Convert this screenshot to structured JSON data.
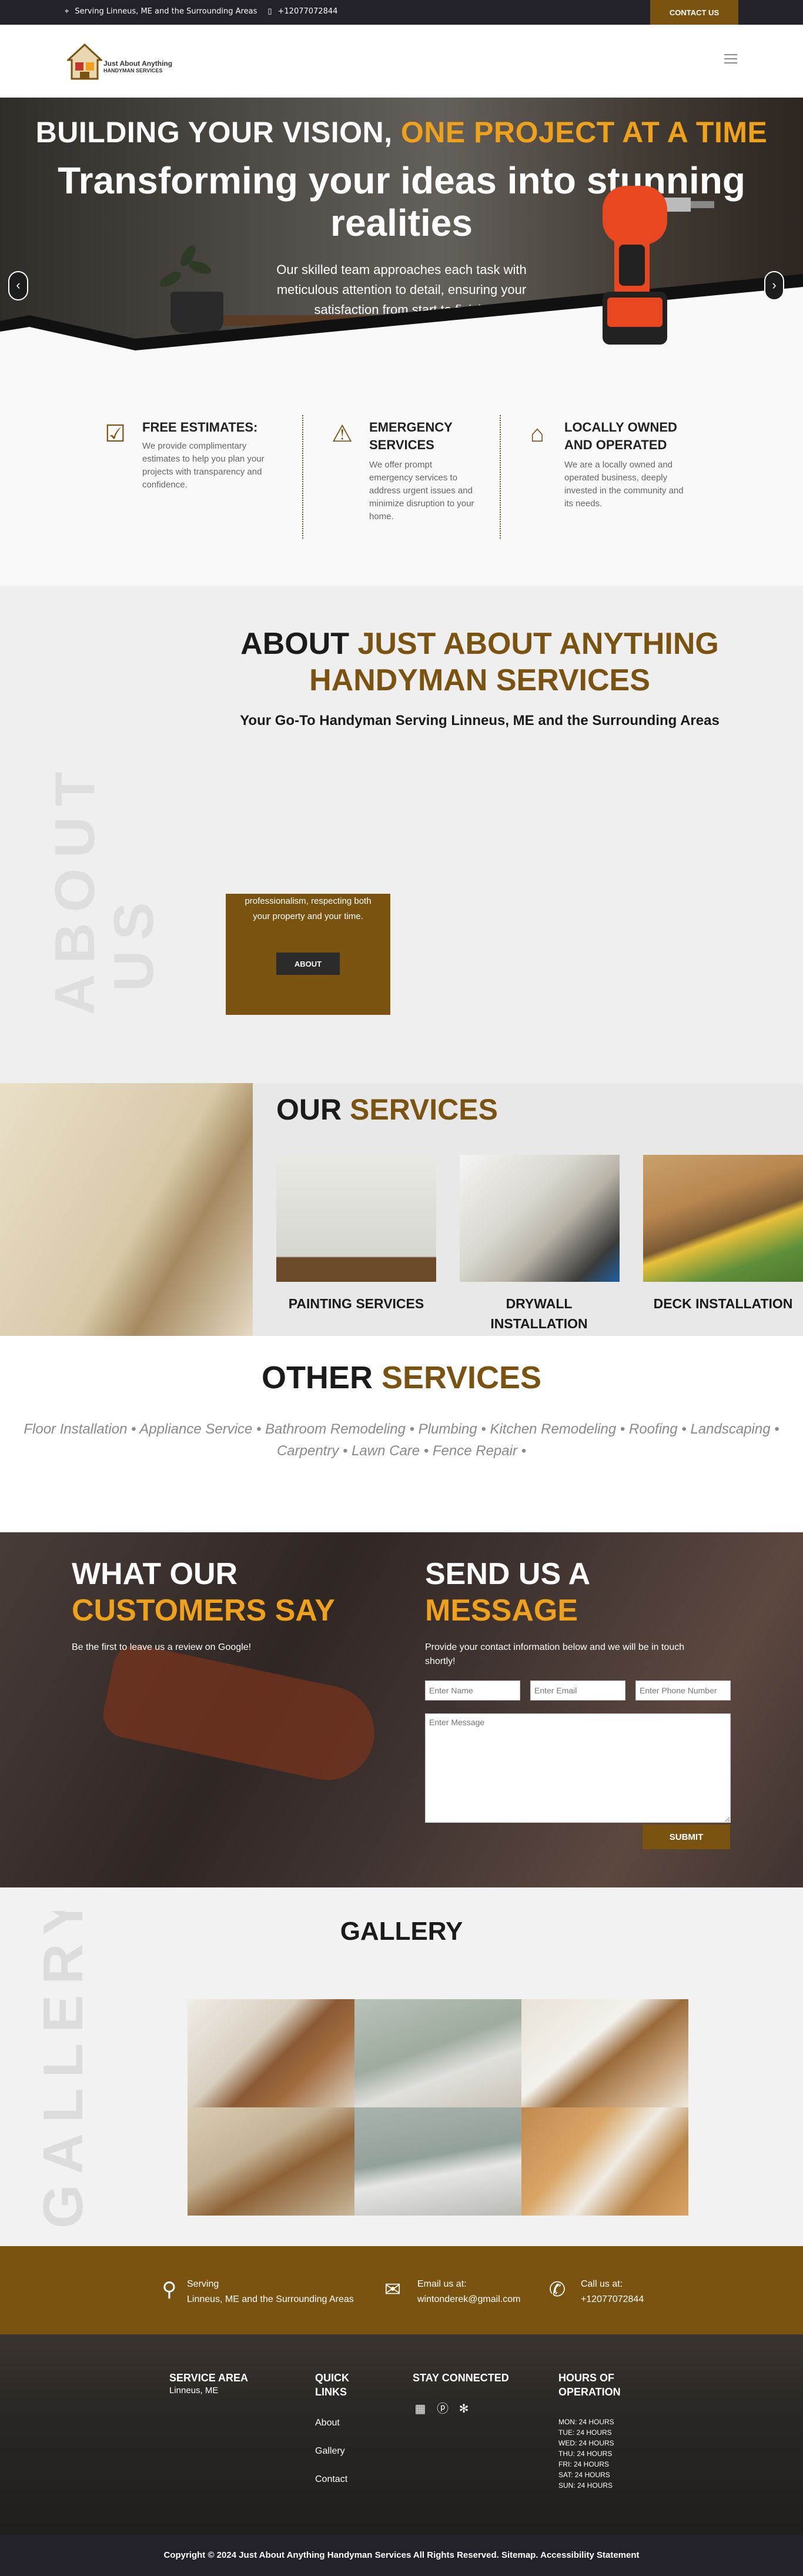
{
  "topbar": {
    "location": "Serving Linneus, ME and the Surrounding Areas",
    "phone": "+12077072844",
    "contact_button": "CONTACT US"
  },
  "logo": {
    "line1": "Just About Anything",
    "line2": "HANDYMAN SERVICES"
  },
  "hero": {
    "tagline_part1": "BUILDING YOUR VISION, ",
    "tagline_part2": "ONE PROJECT AT A TIME",
    "headline": "Transforming your ideas into stunning realities",
    "body": "Our skilled team approaches each task with meticulous attention to detail, ensuring your satisfaction from start to finish.",
    "prev_arrow": "‹",
    "next_arrow": "›"
  },
  "features": [
    {
      "icon": "checklist-icon",
      "title": "FREE ESTIMATES:",
      "text": "We provide complimentary estimates to help you plan your projects with transparency and confidence."
    },
    {
      "icon": "siren-icon",
      "title": "EMERGENCY SERVICES",
      "text": "We offer prompt emergency services to address urgent issues and minimize disruption to your home."
    },
    {
      "icon": "storefront-icon",
      "title": "LOCALLY OWNED AND OPERATED",
      "text": "We are a locally owned and operated business, deeply invested in the community and its needs."
    }
  ],
  "about": {
    "title_part1": "ABOUT ",
    "title_part2": "JUST ABOUT ANYTHING HANDYMAN SERVICES",
    "subtitle": "Your Go-To Handyman Serving Linneus, ME and the Surrounding Areas",
    "ghost_text_1": "ABOUT",
    "ghost_text_2": "US",
    "box_text": "professionalism, respecting both your property and your time.",
    "button": "ABOUT"
  },
  "services": {
    "title_part1": "OUR ",
    "title_part2": "SERVICES",
    "items": [
      {
        "label": "PAINTING SERVICES"
      },
      {
        "label": "DRYWALL INSTALLATION"
      },
      {
        "label": "DECK INSTALLATION"
      }
    ]
  },
  "other_services": {
    "title_part1": "OTHER ",
    "title_part2": "SERVICES",
    "list": "Floor Installation • Appliance Service • Bathroom Remodeling • Plumbing • Kitchen Remodeling • Roofing • Landscaping • Carpentry • Lawn Care • Fence Repair •"
  },
  "testimonials": {
    "title_part1": "WHAT OUR",
    "title_part2": "CUSTOMERS SAY",
    "text": "Be the first to leave us a review on Google!"
  },
  "message": {
    "title_part1": "SEND US A",
    "title_part2": "MESSAGE",
    "text": "Provide your contact information below and we will be in touch shortly!",
    "name_placeholder": "Enter Name",
    "email_placeholder": "Enter Email",
    "phone_placeholder": "Enter Phone Number",
    "message_placeholder": "Enter Message",
    "submit": "SUBMIT"
  },
  "gallery": {
    "title": "GALLERY",
    "ghost_text": "GALLERY"
  },
  "contact_strip": {
    "serving_label": "Serving",
    "serving_value": "Linneus, ME and the Surrounding Areas",
    "email_label": "Email us at:",
    "email_value": "wintonderek@gmail.com",
    "phone_label": "Call us at:",
    "phone_value": "+12077072844"
  },
  "footer": {
    "service_area_title": "SERVICE AREA",
    "service_area_value": "Linneus, ME",
    "quick_links_title": "QUICK LINKS",
    "links": [
      "About",
      "Gallery",
      "Contact"
    ],
    "stay_connected_title": "STAY CONNECTED",
    "hours_title": "HOURS OF OPERATION",
    "hours": [
      "MON: 24 HOURS",
      "TUE: 24 HOURS",
      "WED: 24 HOURS",
      "THU: 24 HOURS",
      "FRI: 24 HOURS",
      "SAT: 24 HOURS",
      "SUN: 24 HOURS"
    ]
  },
  "copyright": "Copyright © 2024 Just About Anything Handyman Services All Rights Reserved. Sitemap. Accessibility Statement",
  "colors": {
    "brand_brown": "#7a5310",
    "accent_orange": "#f0a11b",
    "dark_bar": "#23222b"
  }
}
